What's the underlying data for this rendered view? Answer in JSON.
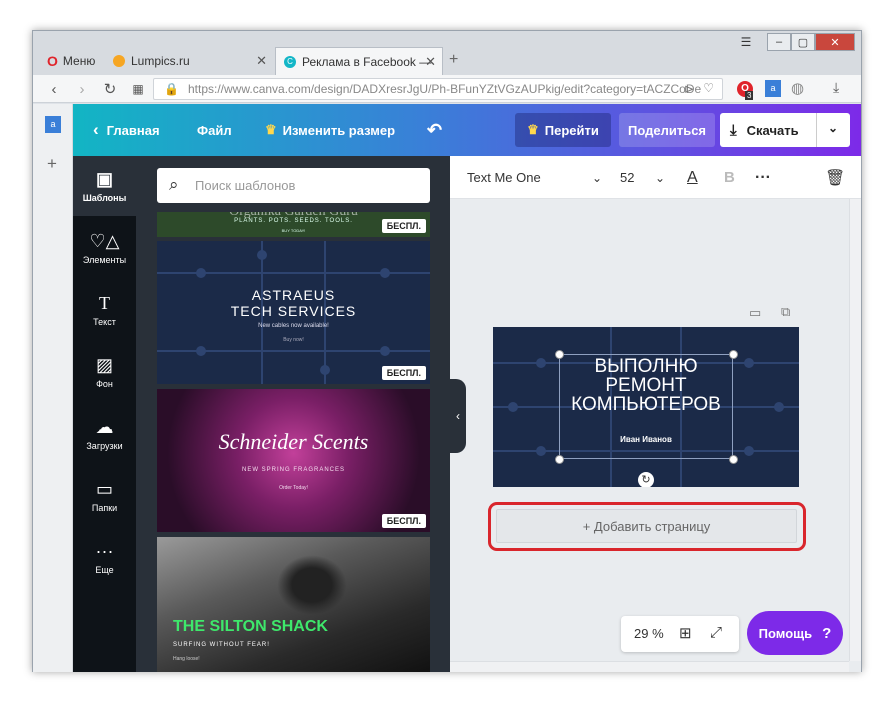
{
  "browser": {
    "menu_label": "Меню",
    "tabs": [
      {
        "title": "Lumpics.ru"
      },
      {
        "title": "Реклама в Facebook — B"
      }
    ],
    "url": "https://www.canva.com/design/DADXresrJgU/Ph-BFunYZtVGzAUPkig/edit?category=tACZCoDe",
    "ext_badge": "3"
  },
  "canva": {
    "home_label": "Главная",
    "file_label": "Файл",
    "resize_label": "Изменить размер",
    "go_label": "Перейти",
    "share_label": "Поделиться",
    "download_label": "Скачать",
    "nav": [
      {
        "label": "Шаблоны"
      },
      {
        "label": "Элементы"
      },
      {
        "label": "Текст"
      },
      {
        "label": "Фон"
      },
      {
        "label": "Загрузки"
      },
      {
        "label": "Папки"
      },
      {
        "label": "Еще"
      }
    ],
    "search_placeholder": "Поиск шаблонов",
    "free_badge": "БЕСПЛ.",
    "templates": [
      {
        "title": "Organika Garden Guru",
        "subtitle": "PLANTS. POTS. SEEDS. TOOLS.",
        "note": "BUY TODAY!"
      },
      {
        "title": "ASTRAEUS",
        "title2": "TECH SERVICES",
        "subtitle": "New cables now available!",
        "note": "Buy now!"
      },
      {
        "title": "Schneider Scents",
        "subtitle": "NEW SPRING FRAGRANCES",
        "note": "Order Today!"
      },
      {
        "title": "THE SILTON SHACK",
        "subtitle": "SURFING WITHOUT FEAR!",
        "note": "Hang loose!"
      }
    ],
    "font_name": "Text Me One",
    "font_size": "52",
    "design_text": [
      "ВЫПОЛНЮ",
      "РЕМОНТ",
      "КОМПЬЮТЕРОВ"
    ],
    "design_name": "Иван Иванов",
    "add_page_label": "+ Добавить страницу",
    "zoom_label": "29 %",
    "help_label": "Помощь",
    "help_q": "?"
  }
}
